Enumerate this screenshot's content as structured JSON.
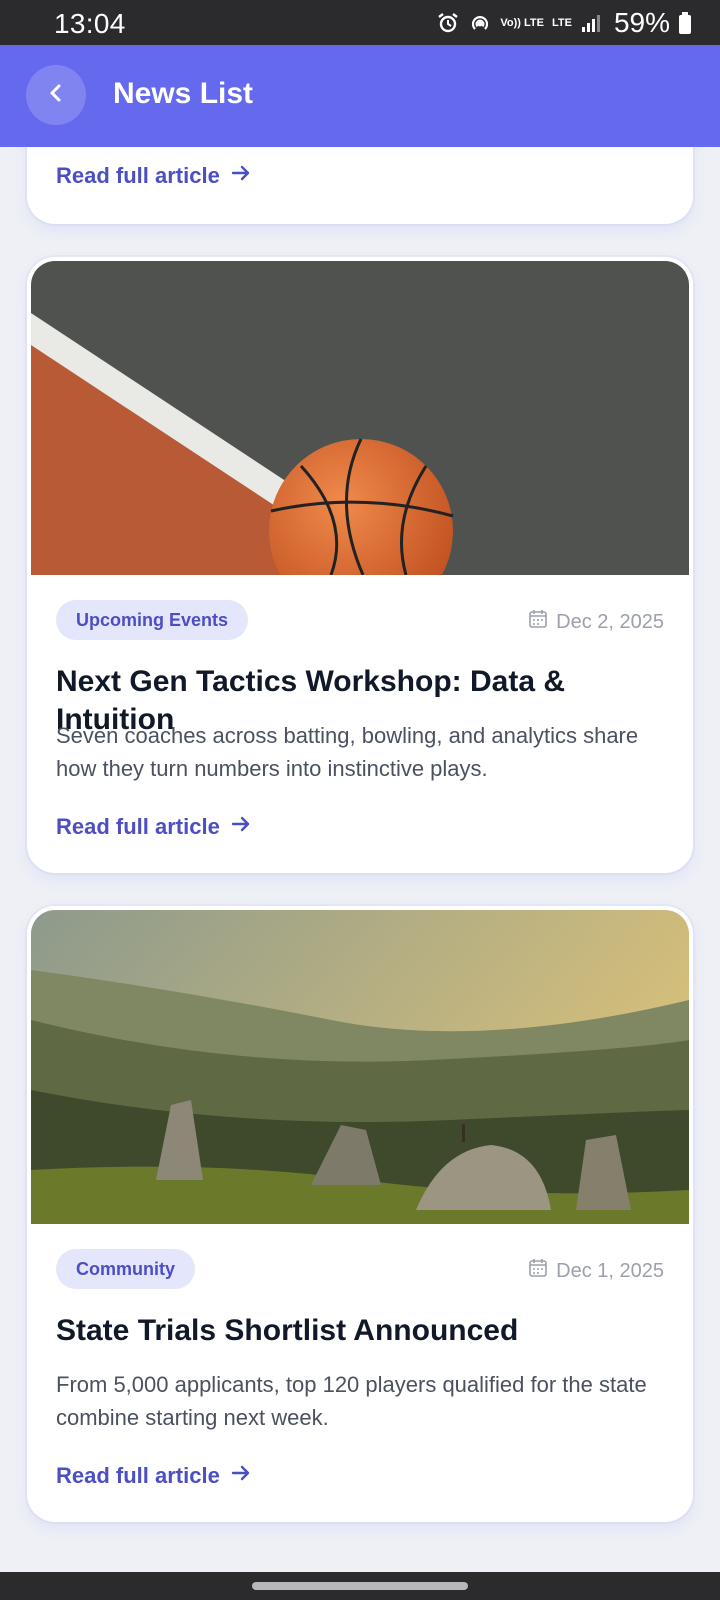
{
  "status_bar": {
    "time": "13:04",
    "battery": "59%",
    "icons": [
      "alarm-icon",
      "hotspot-icon",
      "volte-icon",
      "lte-icon",
      "signal-icon",
      "battery-icon"
    ],
    "volte_label": "Vo)) LTE",
    "lte_label": "LTE"
  },
  "header": {
    "title": "News List",
    "back_icon": "chevron-left-icon",
    "color": "#6469ed"
  },
  "articles": [
    {
      "read_more": "Read full article"
    },
    {
      "category": "Upcoming Events",
      "date": "Dec 2, 2025",
      "title": "Next Gen Tactics Workshop: Data & Intuition",
      "summary": "Seven coaches across batting, bowling, and analytics share how they turn numbers into instinctive plays.",
      "read_more": "Read full article",
      "image": "basketball-court-photo"
    },
    {
      "category": "Community",
      "date": "Dec 1, 2025",
      "title": "State Trials Shortlist Announced",
      "summary": "From 5,000 applicants, top 120 players qualified for the state combine starting next week.",
      "read_more": "Read full article",
      "image": "mountain-landscape-photo"
    }
  ],
  "colors": {
    "accent": "#6469ed",
    "link": "#4c4fc4",
    "pill_bg": "#e4e6fb",
    "background": "#eef0f6"
  }
}
